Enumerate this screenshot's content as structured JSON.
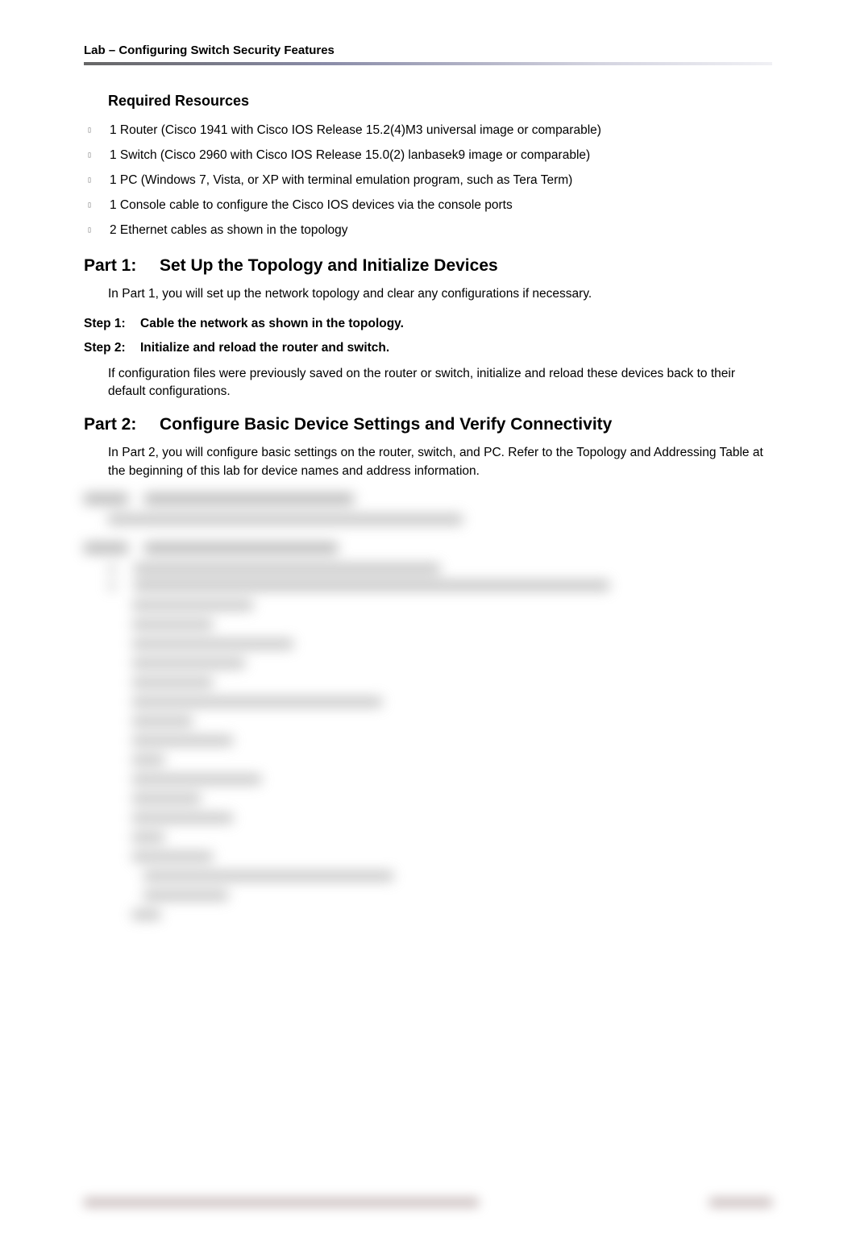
{
  "header": {
    "title": "Lab – Configuring Switch Security Features"
  },
  "required_resources": {
    "heading": "Required Resources",
    "items": [
      "1 Router (Cisco 1941 with Cisco IOS Release 15.2(4)M3 universal image or comparable)",
      "1 Switch (Cisco 2960 with Cisco IOS Release 15.0(2) lanbasek9 image or comparable)",
      "1 PC (Windows 7, Vista, or XP with terminal emulation program, such as Tera Term)",
      "1 Console cable to configure the Cisco IOS devices via the console ports",
      "2 Ethernet cables as shown in the topology"
    ]
  },
  "part1": {
    "label": "Part 1:",
    "title": "Set Up the Topology and Initialize Devices",
    "desc": "In Part 1, you will set up the network topology and clear any configurations if necessary.",
    "step1": {
      "label": "Step 1:",
      "title": "Cable the network as shown in the topology."
    },
    "step2": {
      "label": "Step 2:",
      "title": "Initialize and reload the router and switch.",
      "desc": "If configuration files were previously saved on the router or switch, initialize and reload these devices back to their default configurations."
    }
  },
  "part2": {
    "label": "Part 2:",
    "title": "Configure Basic Device Settings and Verify Connectivity",
    "desc": "In Part 2, you will configure basic settings on the router, switch, and PC. Refer to the Topology and Addressing Table at the beginning of this lab for device names and address information."
  }
}
